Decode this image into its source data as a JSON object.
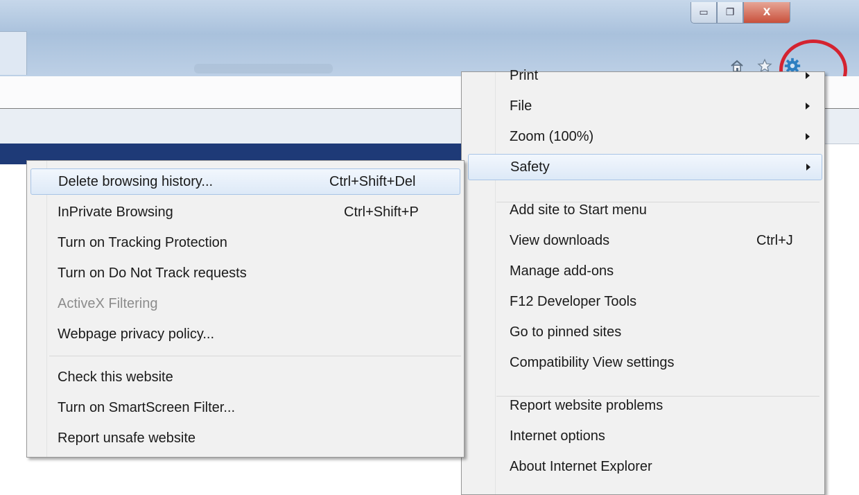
{
  "window": {
    "minimize": "▭",
    "restore": "❐",
    "close": "X"
  },
  "toolbar": {
    "icons": [
      "home-icon",
      "favorites-star-icon",
      "tools-gear-icon"
    ],
    "highlight_color": "#d42330"
  },
  "tools_menu": {
    "items": [
      {
        "label": "Print",
        "submenu": true
      },
      {
        "label": "File",
        "submenu": true
      },
      {
        "label": "Zoom (100%)",
        "submenu": true
      },
      {
        "label": "Safety",
        "submenu": true,
        "highlighted": true
      },
      {
        "label": "Add site to Start menu"
      },
      {
        "label": "View downloads",
        "shortcut": "Ctrl+J"
      },
      {
        "label": "Manage add-ons"
      },
      {
        "label": "F12 Developer Tools"
      },
      {
        "label": "Go to pinned sites"
      },
      {
        "label": "Compatibility View settings"
      },
      {
        "label": "Report website problems"
      },
      {
        "label": "Internet options"
      },
      {
        "label": "About Internet Explorer"
      }
    ]
  },
  "safety_menu": {
    "items": [
      {
        "label": "Delete browsing history...",
        "shortcut": "Ctrl+Shift+Del",
        "highlighted": true
      },
      {
        "label": "InPrivate Browsing",
        "shortcut": "Ctrl+Shift+P"
      },
      {
        "label": "Turn on Tracking Protection"
      },
      {
        "label": "Turn on Do Not Track requests"
      },
      {
        "label": "ActiveX Filtering",
        "disabled": true
      },
      {
        "label": "Webpage privacy policy..."
      },
      {
        "label": "Check this website"
      },
      {
        "label": "Turn on SmartScreen Filter..."
      },
      {
        "label": "Report unsafe website"
      }
    ]
  }
}
